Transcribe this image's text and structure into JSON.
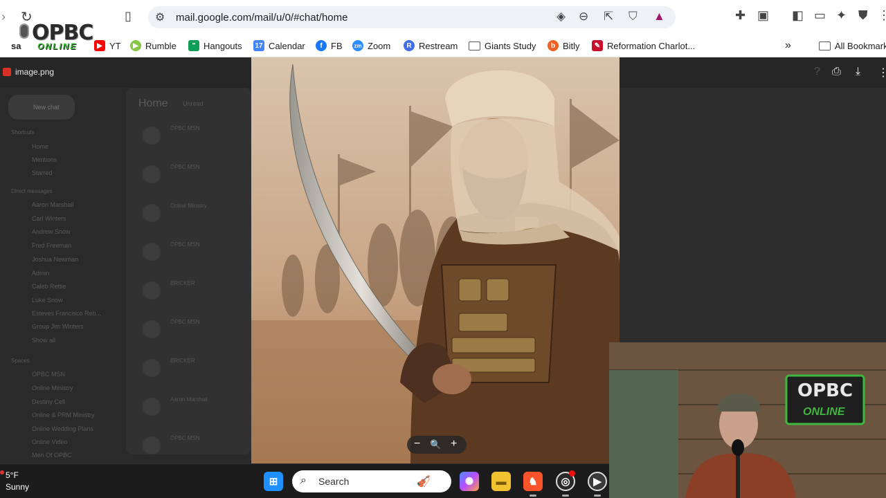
{
  "browser": {
    "url": "mail.google.com/mail/u/0/#chat/home",
    "bookmarks": [
      {
        "label": "YT",
        "icon": "youtube-icon",
        "color": "#ff0000"
      },
      {
        "label": "Rumble",
        "icon": "rumble-icon",
        "color": "#85c742"
      },
      {
        "label": "Hangouts",
        "icon": "hangouts-icon",
        "color": "#0f9d58"
      },
      {
        "label": "Calendar",
        "icon": "calendar-icon",
        "color": "#4285f4"
      },
      {
        "label": "FB",
        "icon": "facebook-icon",
        "color": "#1877f2"
      },
      {
        "label": "Zoom",
        "icon": "zoom-icon",
        "color": "#2d8cff"
      },
      {
        "label": "Restream",
        "icon": "restream-icon",
        "color": "#3f6fe8"
      },
      {
        "label": "Giants Study",
        "icon": "folder-icon",
        "color": "#555555"
      },
      {
        "label": "Bitly",
        "icon": "bitly-icon",
        "color": "#ee6123"
      },
      {
        "label": "Reformation Charlot...",
        "icon": "reformation-icon",
        "color": "#c8102e"
      }
    ],
    "overflow_label": "»",
    "all_bookmarks": "All Bookmark"
  },
  "logo": {
    "title": "OPBC",
    "subtitle": "ONLINE",
    "prefix": "sa"
  },
  "viewer": {
    "file_name": "image.png"
  },
  "gmail": {
    "new_chat": "New chat",
    "panel_title": "Home",
    "panel_filter": "Unread",
    "sections": [
      "Shortcuts",
      "Direct messages",
      "Spaces"
    ],
    "shortcuts": [
      "Home",
      "Mentions",
      "Starred"
    ],
    "direct_messages": [
      "Aaron Marshall",
      "Carl Winters",
      "Andrew Snow",
      "Fred Freeman",
      "Joshua Newman",
      "Admin",
      "Caleb Rettie",
      "Luke Snow",
      "Esteves Francisco Reb...",
      "Group Jim Winters",
      "Show all"
    ],
    "spaces": [
      "OPBC MSN",
      "Online Ministry",
      "Destiny Cell",
      "Online & PRM Ministry",
      "Online Wedding Plans",
      "Online Video",
      "Men Of OPBC"
    ],
    "threads": [
      "OPBC MSN",
      "OPBC MSN",
      "Online Ministry",
      "OPBC MSN",
      "BRICKER",
      "OPBC MSN",
      "BRICKER",
      "Aaron Marshall",
      "OPBC MSN"
    ]
  },
  "zoom_controls": {
    "minus": "−",
    "magnifier": "🔍",
    "plus": "+"
  },
  "taskbar": {
    "temperature": "5°F",
    "condition": "Sunny",
    "search_placeholder": "Search"
  },
  "webcam": {
    "sign_title": "OPBC",
    "sign_subtitle": "ONLINE"
  }
}
